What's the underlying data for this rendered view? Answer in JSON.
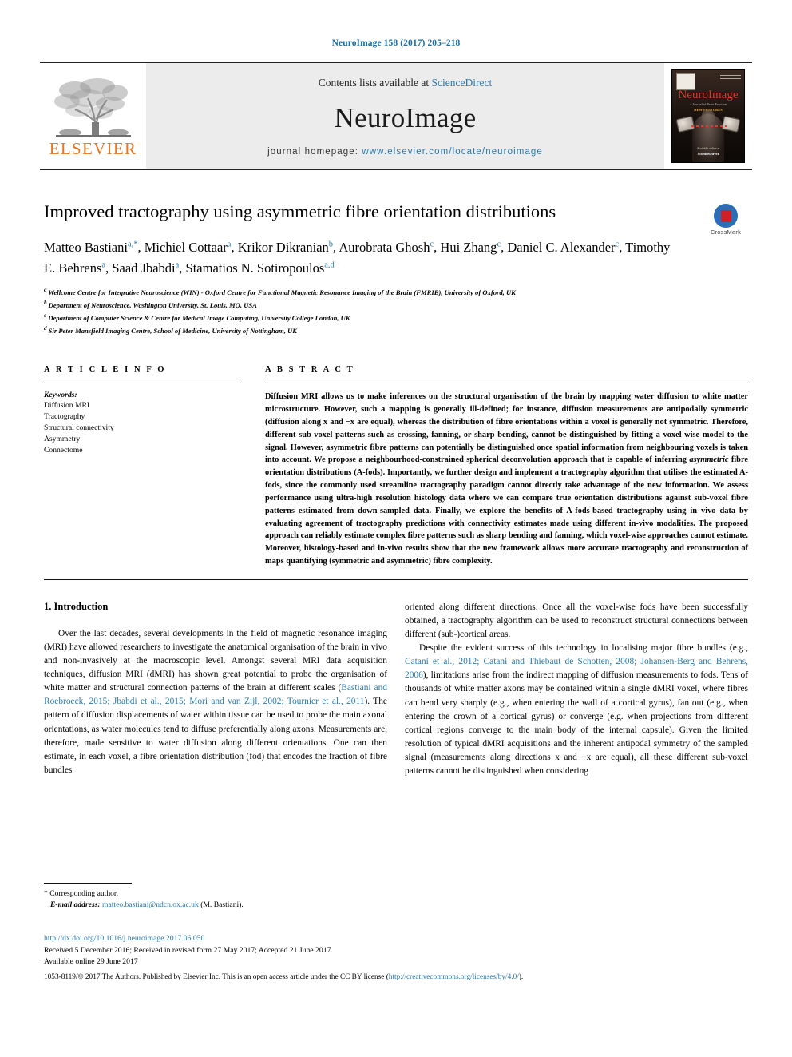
{
  "running_head": "NeuroImage 158 (2017) 205–218",
  "masthead": {
    "publisher_logo_text": "ELSEVIER",
    "contents_prefix": "Contents lists available at",
    "contents_link": "ScienceDirect",
    "journal_name": "NeuroImage",
    "homepage_label": "journal homepage:",
    "homepage_url": "www.elsevier.com/locate/neuroimage",
    "cover": {
      "title": "NeuroImage",
      "sub": "A Journal of Brain Function",
      "sub2": "NEW FEATURES",
      "foot_line1": "Available online at",
      "foot_line2": "ScienceDirect"
    }
  },
  "article": {
    "title": "Improved tractography using asymmetric fibre orientation distributions",
    "crossmark_label": "CrossMark",
    "authors_line1": "Matteo Bastiani",
    "authors": [
      {
        "name": "Matteo Bastiani",
        "sup": "a,",
        "star": true,
        "sep": ", "
      },
      {
        "name": "Michiel Cottaar",
        "sup": "a",
        "star": false,
        "sep": ", "
      },
      {
        "name": "Krikor Dikranian",
        "sup": "b",
        "star": false,
        "sep": ", "
      },
      {
        "name": "Aurobrata Ghosh",
        "sup": "c",
        "star": false,
        "sep": ", "
      },
      {
        "name": "Hui Zhang",
        "sup": "c",
        "star": false,
        "sep": ", "
      },
      {
        "name": "Daniel C. Alexander",
        "sup": "c",
        "star": false,
        "sep": ", "
      },
      {
        "name": "Timothy E. Behrens",
        "sup": "a",
        "star": false,
        "sep": ", "
      },
      {
        "name": "Saad Jbabdi",
        "sup": "a",
        "star": false,
        "sep": ", "
      },
      {
        "name": "Stamatios N. Sotiropoulos",
        "sup": "a,d",
        "star": false,
        "sep": ""
      }
    ],
    "affiliations": [
      {
        "sup": "a",
        "text": "Wellcome Centre for Integrative Neuroscience (WIN) - Oxford Centre for Functional Magnetic Resonance Imaging of the Brain (FMRIB), University of Oxford, UK"
      },
      {
        "sup": "b",
        "text": "Department of Neuroscience, Washington University, St. Louis, MO, USA"
      },
      {
        "sup": "c",
        "text": "Department of Computer Science & Centre for Medical Image Computing, University College London, UK"
      },
      {
        "sup": "d",
        "text": "Sir Peter Mansfield Imaging Centre, School of Medicine, University of Nottingham, UK"
      }
    ]
  },
  "article_info": {
    "heading": "A R T I C L E  I N F O",
    "keywords_label": "Keywords:",
    "keywords": [
      "Diffusion MRI",
      "Tractography",
      "Structural connectivity",
      "Asymmetry",
      "Connectome"
    ]
  },
  "abstract": {
    "heading": "A B S T R A C T",
    "part1": "Diffusion MRI allows us to make inferences on the structural organisation of the brain by mapping water diffusion to white matter microstructure. However, such a mapping is generally ill-defined; for instance, diffusion measurements are antipodally symmetric (diffusion along x and −x are equal), whereas the distribution of fibre orientations within a voxel is generally not symmetric. Therefore, different sub-voxel patterns such as crossing, fanning, or sharp bending, cannot be distinguished by fitting a voxel-wise model to the signal. However, asymmetric fibre patterns can potentially be distinguished once spatial information from neighbouring voxels is taken into account. We propose a neighbourhood-constrained spherical deconvolution approach that is capable of inferring ",
    "italic1": "asymmetric",
    "part2": " fibre orientation distributions (A-fods). Importantly, we further design and implement a tractography algorithm that utilises the estimated A-fods, since the commonly used streamline tractography paradigm cannot directly take advantage of the new information. We assess performance using ultra-high resolution histology data where we can compare true orientation distributions against sub-voxel fibre patterns estimated from down-sampled data. Finally, we explore the benefits of A-fods-based tractography using in vivo data by evaluating agreement of tractography predictions with connectivity estimates made using different in-vivo modalities. The proposed approach can reliably estimate complex fibre patterns such as sharp bending and fanning, which voxel-wise approaches cannot estimate. Moreover, histology-based and in-vivo results show that the new framework allows more accurate tractography and reconstruction of maps quantifying (symmetric and asymmetric) fibre complexity."
  },
  "body": {
    "section_number_title": "1.  Introduction",
    "left_p1_a": "Over the last decades, several developments in the field of magnetic resonance imaging (MRI) have allowed researchers to investigate the anatomical organisation of the brain in vivo and non-invasively at the macroscopic level. Amongst several MRI data acquisition techniques, diffusion MRI (dMRI) has shown great potential to probe the organisation of white matter and structural connection patterns of the brain at different scales (",
    "left_ref1": "Bastiani and Roebroeck, 2015; Jbabdi et al., 2015; Mori and van Zijl, 2002; Tournier et al., 2011",
    "left_p1_b": "). The pattern of diffusion displacements of water within tissue can be used to probe the main axonal orientations, as water molecules tend to diffuse preferentially along axons. Measurements are, therefore, made sensitive to water diffusion along different orientations. One can then estimate, in each voxel, a fibre orientation distribution (fod) that encodes the fraction of fibre bundles",
    "right_p1": "oriented along different directions. Once all the voxel-wise fods have been successfully obtained, a tractography algorithm can be used to reconstruct structural connections between different (sub-)cortical areas.",
    "right_p2_a": "Despite the evident success of this technology in localising major fibre bundles (e.g., ",
    "right_ref1": "Catani et al., 2012; Catani and Thiebaut de Schotten, 2008; Johansen-Berg and Behrens, 2006",
    "right_p2_b": "), limitations arise from the indirect mapping of diffusion measurements to fods. Tens of thousands of white matter axons may be contained within a single dMRI voxel, where fibres can bend very sharply (e.g., when entering the wall of a cortical gyrus), fan out (e.g., when entering the crown of a cortical gyrus) or converge (e.g. when projections from different cortical regions converge to the main body of the internal capsule). Given the limited resolution of typical dMRI acquisitions and the inherent antipodal symmetry of the sampled signal (measurements along directions x and −x are equal), all these different sub-voxel patterns cannot be distinguished when considering"
  },
  "footnote": {
    "corresponding": "* Corresponding author.",
    "email_label": "E-mail address:",
    "email": "matteo.bastiani@ndcn.ox.ac.uk",
    "email_suffix": "(M. Bastiani)."
  },
  "footer": {
    "doi": "http://dx.doi.org/10.1016/j.neuroimage.2017.06.050",
    "history": "Received 5 December 2016; Received in revised form 27 May 2017; Accepted 21 June 2017",
    "available": "Available online 29 June 2017",
    "copyright_pre": "1053-8119/© 2017 The Authors. Published by Elsevier Inc. This is an open access article under the CC BY license (",
    "license_url": "http://creativecommons.org/licenses/by/4.0/",
    "copyright_post": ")."
  },
  "colors": {
    "link": "#2a7ab0",
    "elsevier_orange": "#E87722",
    "crossmark_blue": "#2a6fb5",
    "crossmark_red": "#cf2027"
  }
}
